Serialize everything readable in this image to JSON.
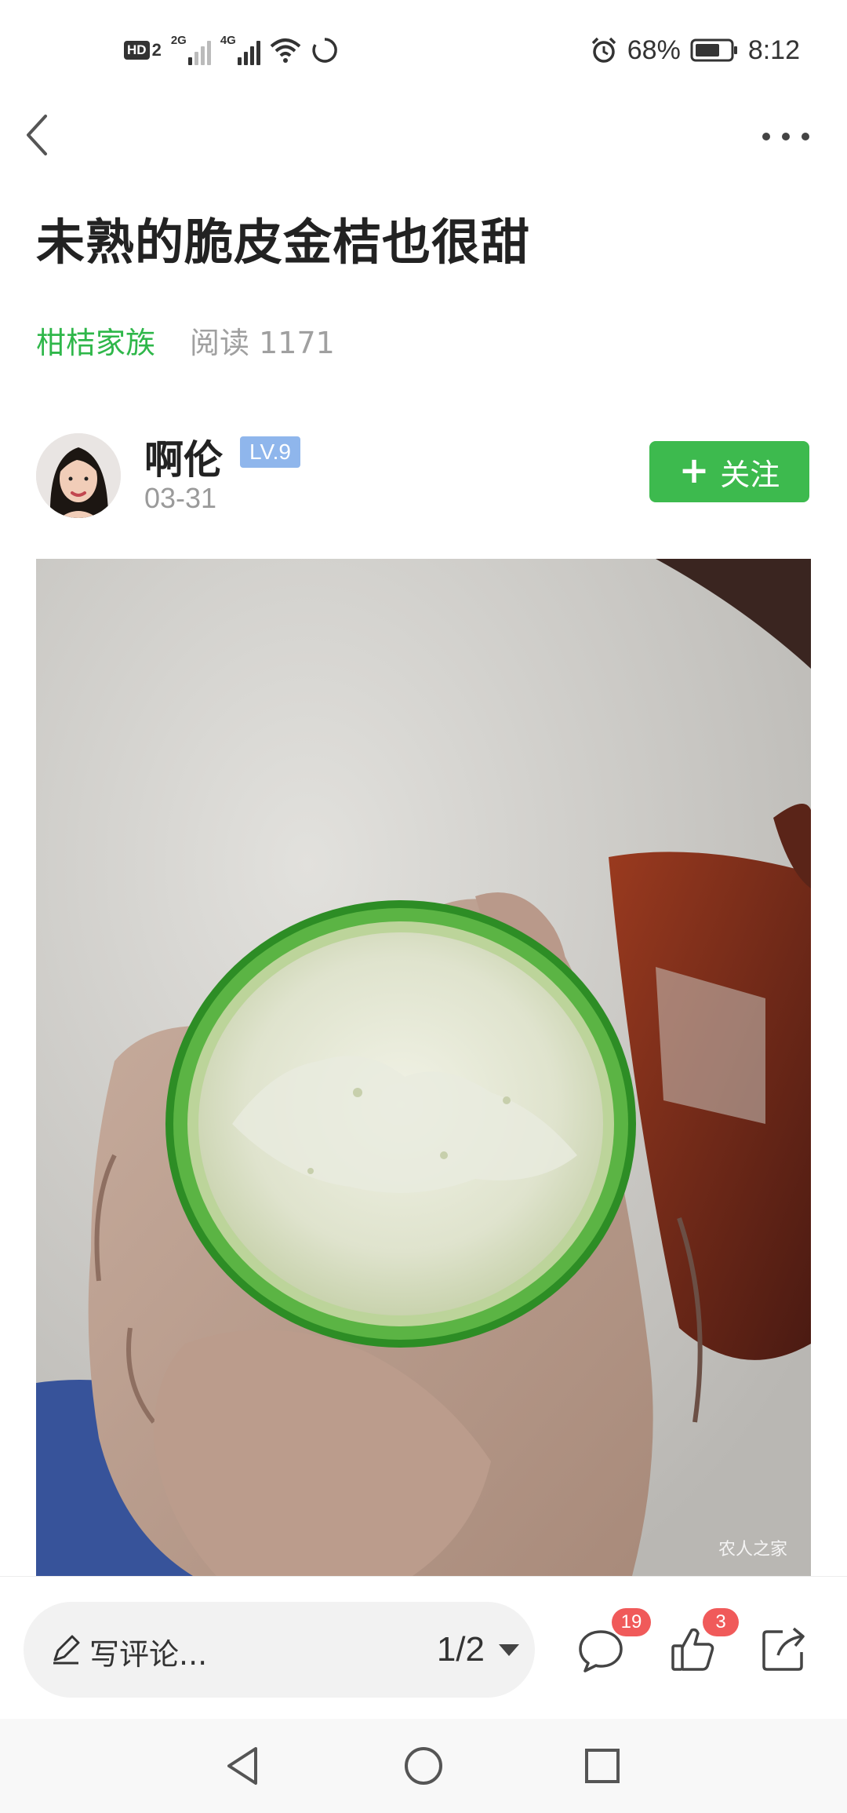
{
  "status_bar": {
    "hd_label": "HD",
    "hd_num": "2",
    "sim1_label": "2G",
    "sim2_label": "4G",
    "battery": "68%",
    "time": "8:12"
  },
  "nav": {
    "back_icon": "chevron-left-icon",
    "more_icon": "ellipsis-icon"
  },
  "article": {
    "title": "未熟的脆皮金桔也很甜",
    "category": "柑桔家族",
    "reads": "阅读 1171"
  },
  "author": {
    "name": "啊伦",
    "level": "LV.9",
    "date": "03-31",
    "follow_label": "关注"
  },
  "photo": {
    "watermark": "农人之家"
  },
  "bottom_bar": {
    "comment_placeholder": "写评论...",
    "page_indicator": "1/2",
    "comment_count": "19",
    "like_count": "3"
  },
  "colors": {
    "accent_green": "#3dba4e",
    "category_green": "#2fb74a",
    "level_blue": "#8fb6ec",
    "badge_red": "#f05a5a"
  }
}
